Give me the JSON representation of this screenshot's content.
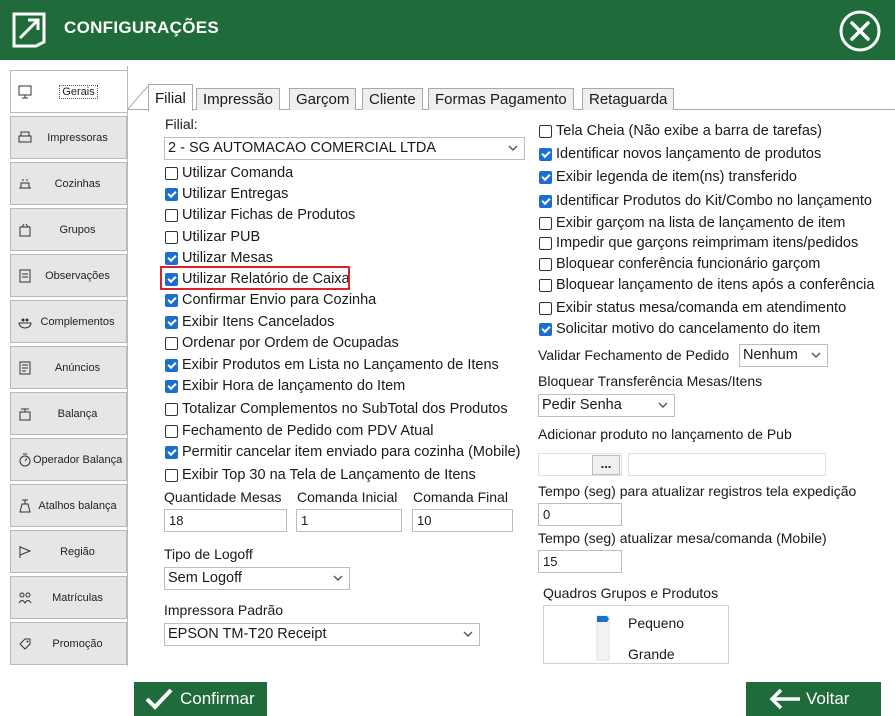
{
  "window": {
    "title": "CONFIGURAÇÕES"
  },
  "colors": {
    "brand": "#1f6b3a",
    "check": "#1a6fd1",
    "highlight": "#d9232b"
  },
  "sidebar": {
    "items": [
      {
        "label": "Gerais",
        "icon": "monitor-icon",
        "active": true
      },
      {
        "label": "Impressoras",
        "icon": "printer-icon"
      },
      {
        "label": "Cozinhas",
        "icon": "kitchen-icon"
      },
      {
        "label": "Grupos",
        "icon": "groups-icon"
      },
      {
        "label": "Observações",
        "icon": "notes-icon"
      },
      {
        "label": "Complementos",
        "icon": "complements-icon"
      },
      {
        "label": "Anúncios",
        "icon": "ads-icon"
      },
      {
        "label": "Balança",
        "icon": "scale-icon"
      },
      {
        "label": "Operador Balança",
        "icon": "scale-operator-icon"
      },
      {
        "label": "Atalhos balança",
        "icon": "scale-shortcut-icon"
      },
      {
        "label": "Região",
        "icon": "flag-icon"
      },
      {
        "label": "Matrículas",
        "icon": "enroll-icon"
      },
      {
        "label": "Promoção",
        "icon": "promo-icon"
      }
    ]
  },
  "tabs": [
    "Filial",
    "Impressão",
    "Garçom",
    "Cliente",
    "Formas Pagamento",
    "Retaguarda"
  ],
  "left": {
    "filial_label": "Filial:",
    "filial_value": "2 - SG AUTOMACAO COMERCIAL LTDA",
    "checkboxes": [
      {
        "label": "Utilizar Comanda",
        "checked": false
      },
      {
        "label": "Utilizar Entregas",
        "checked": true
      },
      {
        "label": "Utilizar Fichas de Produtos",
        "checked": false
      },
      {
        "label": "Utilizar PUB",
        "checked": false
      },
      {
        "label": "Utilizar Mesas",
        "checked": true
      },
      {
        "label": "Utilizar Relatório de Caixa",
        "checked": true
      },
      {
        "label": "Confirmar Envio para Cozinha",
        "checked": true
      },
      {
        "label": "Exibir Itens Cancelados",
        "checked": true
      },
      {
        "label": "Ordenar por Ordem de Ocupadas",
        "checked": false
      },
      {
        "label": "Exibir Produtos em Lista no Lançamento de Itens",
        "checked": true
      },
      {
        "label": "Exibir Hora de lançamento do Item",
        "checked": true
      },
      {
        "label": "Totalizar Complementos no SubTotal dos Produtos",
        "checked": false
      },
      {
        "label": "Fechamento de Pedido com PDV Atual",
        "checked": false
      },
      {
        "label": "Permitir cancelar item enviado para cozinha (Mobile)",
        "checked": true
      },
      {
        "label": "Exibir Top 30 na Tela de Lançamento de Itens",
        "checked": false
      }
    ],
    "qtd_mesas_label": "Quantidade Mesas",
    "qtd_mesas_value": "18",
    "comanda_inicial_label": "Comanda Inicial",
    "comanda_inicial_value": "1",
    "comanda_final_label": "Comanda Final",
    "comanda_final_value": "10",
    "logoff_label": "Tipo de Logoff",
    "logoff_value": "Sem Logoff",
    "impressora_label": "Impressora Padrão",
    "impressora_value": "EPSON TM-T20 Receipt"
  },
  "right": {
    "checkboxes": [
      {
        "label": "Tela Cheia (Não exibe a barra de tarefas)",
        "checked": false
      },
      {
        "label": "Identificar novos lançamento de produtos",
        "checked": true
      },
      {
        "label": "Exibir legenda de item(ns) transferido",
        "checked": true
      },
      {
        "label": "Identificar Produtos do Kit/Combo no lançamento",
        "checked": true
      },
      {
        "label": "Exibir garçom na lista de lançamento de item",
        "checked": false
      },
      {
        "label": "Impedir que garçons reimprimam itens/pedidos",
        "checked": false
      },
      {
        "label": "Bloquear conferência funcionário garçom",
        "checked": false
      },
      {
        "label": "Bloquear lançamento de itens após a conferência",
        "checked": false
      },
      {
        "label": "Exibir status mesa/comanda em atendimento",
        "checked": false
      },
      {
        "label": "Solicitar motivo do cancelamento do item",
        "checked": true
      }
    ],
    "validar_label": "Validar Fechamento de Pedido",
    "validar_value": "Nenhum",
    "bloquear_label": "Bloquear Transferência Mesas/Itens",
    "bloquear_value": "Pedir Senha",
    "adicionar_label": "Adicionar produto no lançamento de Pub",
    "ellipsis_label": "...",
    "tempo_exp_label": "Tempo (seg) para atualizar registros tela expedição",
    "tempo_exp_value": "0",
    "tempo_mesa_label": "Tempo (seg) atualizar mesa/comanda (Mobile)",
    "tempo_mesa_value": "15",
    "quadros_label": "Quadros Grupos e Produtos",
    "quadros_options": [
      "Pequeno",
      "Grande"
    ]
  },
  "footer": {
    "confirm_label": "Confirmar",
    "back_label": "Voltar"
  }
}
